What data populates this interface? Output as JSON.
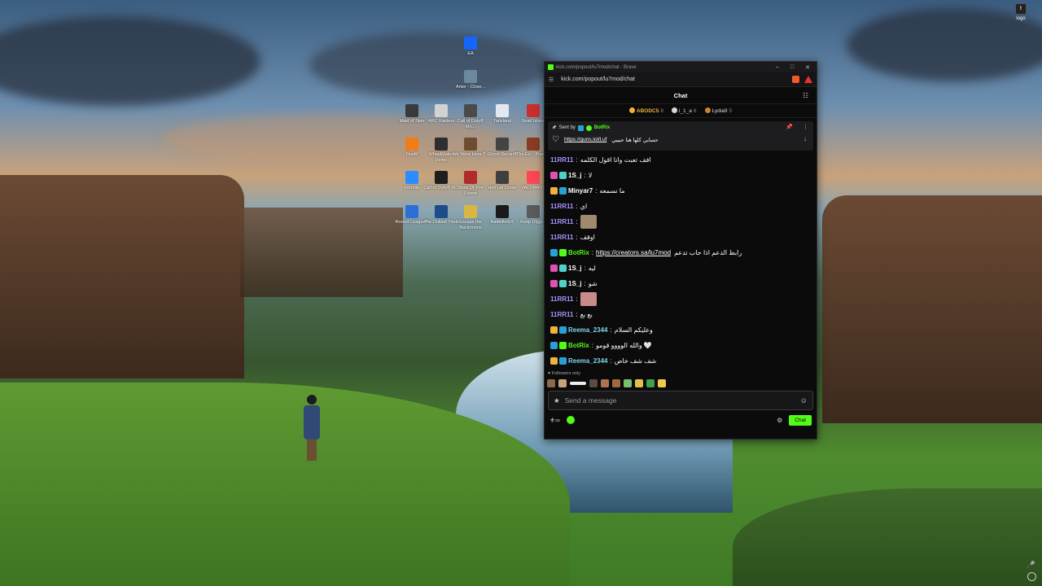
{
  "desktop": {
    "icons": [
      {
        "label": "EA",
        "color": "#1565ff"
      },
      {
        "label": "Arise - Close...",
        "color": "#6b8a9f"
      },
      {
        "label": "Maid of Sker",
        "color": "#3a3a3a"
      },
      {
        "label": "ARC Raiders",
        "color": "#d2d2d2"
      },
      {
        "label": "Call of Duty® Mo...",
        "color": "#4a4a4a"
      },
      {
        "label": "Tarisland",
        "color": "#e3e7f0"
      },
      {
        "label": "Dead Island",
        "color": "#c7302d"
      },
      {
        "label": "FiveM",
        "color": "#f07c1a"
      },
      {
        "label": "WheelMaker Demo",
        "color": "#2e2e2e"
      },
      {
        "label": "We Were Here T...",
        "color": "#6e4c2f"
      },
      {
        "label": "Ghost Recon®",
        "color": "#444"
      },
      {
        "label": "The Ex... Planets",
        "color": "#883d22"
      },
      {
        "label": "Fortnite",
        "color": "#2b8cff"
      },
      {
        "label": "Call of Duty® M...",
        "color": "#1e1e1e"
      },
      {
        "label": "Sons Of The Forest",
        "color": "#b02b2b"
      },
      {
        "label": "Hell Let Loose",
        "color": "#3f3f3f"
      },
      {
        "label": "VALORANT",
        "color": "#ff4655"
      },
      {
        "label": "Rocket League®",
        "color": "#2c6fd8"
      },
      {
        "label": "The Outlast Trials",
        "color": "#1e4b8a"
      },
      {
        "label": "Escape the Backrooms",
        "color": "#d9b640"
      },
      {
        "label": "Battlefield 6",
        "color": "#1a1a1a"
      },
      {
        "label": "Keep Diggi...",
        "color": "#5b5b5b"
      }
    ],
    "top_right_label": "logo"
  },
  "window": {
    "title": "kick.com/popout/lu7mod/chat - Brave",
    "url": "kick.com/popout/lu7mod/chat",
    "chat_title": "Chat",
    "leaders": [
      {
        "name": "ABODC5",
        "count": "8",
        "color": "#f0b23c"
      },
      {
        "name": "i_1_a",
        "count": "6",
        "color": "#d8d8d8"
      },
      {
        "name": "Lydia9",
        "count": "5",
        "color": "#cd7f32"
      }
    ],
    "pinned": {
      "sent_by_label": "Sent by",
      "sender": "BotRix",
      "text": "حسابي كلها هنا حبيبي",
      "link": "https://guns.lol/l.uf"
    },
    "messages": [
      {
        "user": "11RR11",
        "user_color": "#a693ff",
        "text": "افف تعبت وانا اقول الكلمه"
      },
      {
        "user": "1S_j",
        "user_color": "#ffffff",
        "text": "لا"
      },
      {
        "user": "Minyar7",
        "user_color": "#ffffff",
        "text": "ما نسمعه"
      },
      {
        "user": "11RR11",
        "user_color": "#a693ff",
        "text": "اي"
      },
      {
        "user": "11RR11",
        "user_color": "#a693ff",
        "text": ""
      },
      {
        "user": "11RR11",
        "user_color": "#a693ff",
        "text": "اوقف"
      },
      {
        "user": "BotRix",
        "user_color": "#53fc18",
        "link": "https://creators.sa/lu7mod",
        "text": "رابط الدعم اذا حاب تدعم"
      },
      {
        "user": "1S_j",
        "user_color": "#ffffff",
        "text": "ليه"
      },
      {
        "user": "1S_j",
        "user_color": "#ffffff",
        "text": "شو"
      },
      {
        "user": "11RR11",
        "user_color": "#a693ff",
        "text": ""
      },
      {
        "user": "11RR11",
        "user_color": "#a693ff",
        "text": "بع بع"
      },
      {
        "user": "Reema_2344",
        "user_color": "#7fd6e9",
        "text": "وعليكم السلام"
      },
      {
        "user": "BotRix",
        "user_color": "#53fc18",
        "text": "والله الوووو قومو 🤍"
      },
      {
        "user": "Reema_2344",
        "user_color": "#7fd6e9",
        "text": "شف شف خاص"
      }
    ],
    "followers_only": "Followers only",
    "input_placeholder": "Send a message",
    "chat_button": "Chat"
  }
}
